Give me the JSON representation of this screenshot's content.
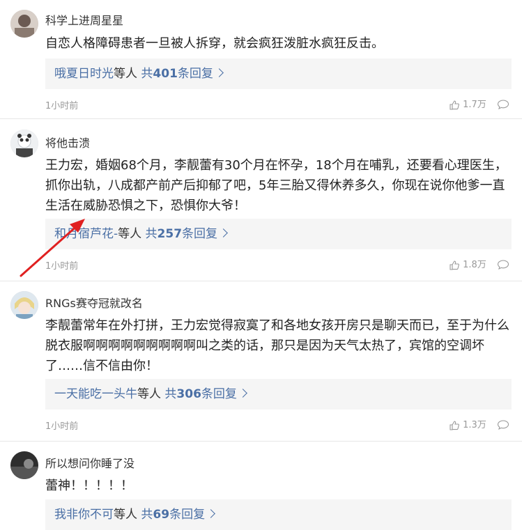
{
  "comments": [
    {
      "username": "科学上进周星星",
      "content": "自恋人格障碍患者一旦被人拆穿，就会疯狂泼脏水疯狂反击。",
      "reply_name": "哦夏日时光",
      "reply_mid": "等人",
      "reply_count_pre": "共",
      "reply_count_num": "401",
      "reply_count_post": "条回复",
      "time": "1小时前",
      "likes": "1.7万",
      "avatar_color": "#6b5a52"
    },
    {
      "username": "将他击溃",
      "content": "王力宏，婚姻68个月，李靓蕾有30个月在怀孕，18个月在哺乳，还要看心理医生，抓你出轨，八成都产前产后抑郁了吧，5年三胎又得休养多久，你现在说你他爹一直生活在威胁恐惧之下，恐惧你大爷！",
      "reply_name": "和月宿芦花-",
      "reply_mid": "等人",
      "reply_count_pre": "共",
      "reply_count_num": "257",
      "reply_count_post": "条回复",
      "time": "1小时前",
      "likes": "1.8万",
      "avatar_color": "#d9dde2"
    },
    {
      "username": "RNGs赛夺冠就改名",
      "content": "李靓蕾常年在外打拼，王力宏觉得寂寞了和各地女孩开房只是聊天而已，至于为什么脱衣服啊啊啊啊啊啊啊啊啊叫之类的话，那只是因为天气太热了，宾馆的空调坏了……信不信由你！",
      "reply_name": "一天能吃一头牛",
      "reply_mid": "等人",
      "reply_count_pre": "共",
      "reply_count_num": "306",
      "reply_count_post": "条回复",
      "time": "1小时前",
      "likes": "1.3万",
      "avatar_color": "#bcd0de"
    },
    {
      "username": "所以想问你睡了没",
      "content": "蕾神！！！！！",
      "reply_name": "我非你不可",
      "reply_mid": "等人",
      "reply_count_pre": "共",
      "reply_count_num": "69",
      "reply_count_post": "条回复",
      "avatar_color": "#3a3a3a"
    }
  ],
  "colors": {
    "link": "#4a6fa5",
    "annotation_arrow": "#e02020"
  },
  "icons": [
    "thumbs-up-icon",
    "comment-bubble-icon",
    "red-annotation-arrow"
  ]
}
